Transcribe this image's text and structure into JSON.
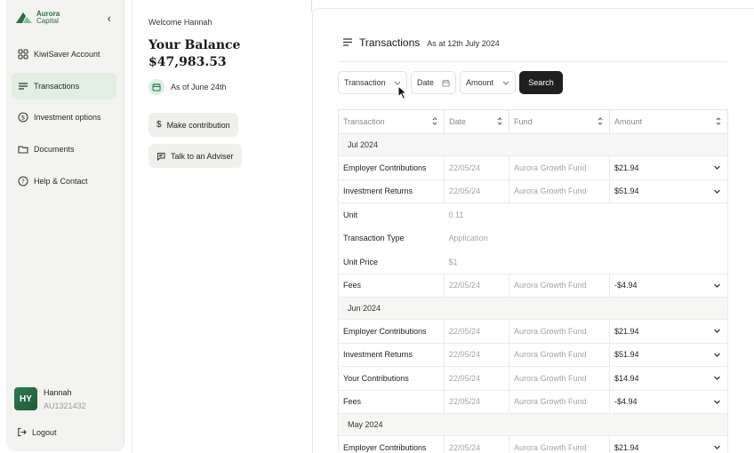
{
  "brand": {
    "name": "Aurora",
    "sub": "Capital",
    "color": "#2a6e3f"
  },
  "sidebar": {
    "items": [
      {
        "label": "KiwiSaver Account",
        "icon": "grid-icon"
      },
      {
        "label": "Transactions",
        "icon": "list-icon",
        "active": true
      },
      {
        "label": "Investment options",
        "icon": "dollar-icon"
      },
      {
        "label": "Documents",
        "icon": "folder-icon"
      },
      {
        "label": "Help & Contact",
        "icon": "help-icon"
      }
    ],
    "user": {
      "initials": "HY",
      "name": "Hannah",
      "id": "AU1321432"
    },
    "logout_label": "Logout"
  },
  "summary": {
    "welcome": "Welcome Hannah",
    "balance_label": "Your Balance",
    "balance_value": "$47,983.53",
    "as_of": "As of June 24th",
    "contribute_label": "Make contribution",
    "adviser_label": "Talk to an Adviser"
  },
  "transactions": {
    "title": "Transactions",
    "as_at": "As at 12th July 2024",
    "filters": {
      "transaction": "Transaction",
      "date": "Date",
      "amount": "Amount",
      "search": "Search"
    },
    "columns": [
      "Transaction",
      "Date",
      "Fund",
      "Amount"
    ],
    "groups": [
      {
        "label": "Jul 2024",
        "rows": [
          {
            "name": "Employer Contributions",
            "date": "22/05/24",
            "fund": "Aurora Growth Fund",
            "amount": "$21.94"
          },
          {
            "name": "Investment Returns",
            "date": "22/05/24",
            "fund": "Aurora Growth Fund",
            "amount": "$51.94",
            "details": [
              {
                "label": "Unit",
                "value": "0.11"
              },
              {
                "label": "Transaction Type",
                "value": "Application"
              },
              {
                "label": "Unit Price",
                "value": "$1"
              }
            ]
          },
          {
            "name": "Fees",
            "date": "22/05/24",
            "fund": "Aurora Growth Fund",
            "amount": "-$4.94"
          }
        ]
      },
      {
        "label": "Jun 2024",
        "rows": [
          {
            "name": "Employer Contributions",
            "date": "22/05/24",
            "fund": "Aurora Growth Fund",
            "amount": "$21.94"
          },
          {
            "name": "Investment Returns",
            "date": "22/05/24",
            "fund": "Aurora Growth Fund",
            "amount": "$51.94"
          },
          {
            "name": "Your Contributions",
            "date": "22/05/24",
            "fund": "Aurora Growth Fund",
            "amount": "$14.94"
          },
          {
            "name": "Fees",
            "date": "22/05/24",
            "fund": "Aurora Growth Fund",
            "amount": "-$4.94"
          }
        ]
      },
      {
        "label": "May 2024",
        "rows": [
          {
            "name": "Employer Contributions",
            "date": "22/05/24",
            "fund": "Aurora Growth Fund",
            "amount": "$21.94"
          }
        ]
      }
    ]
  }
}
